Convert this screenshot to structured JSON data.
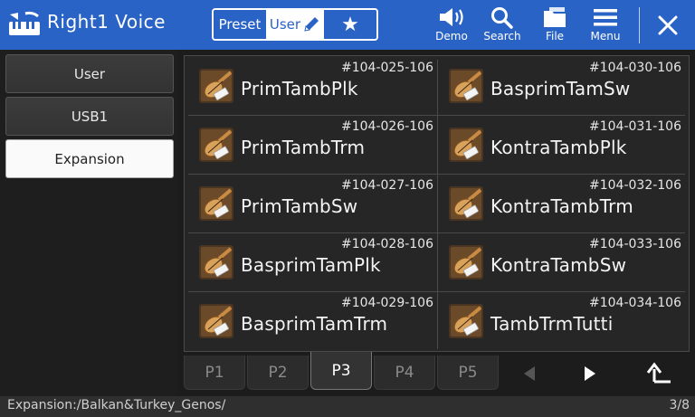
{
  "header": {
    "title": "Right1 Voice",
    "icon": "keyboard-voice-icon",
    "filters": {
      "preset_label": "Preset",
      "user_label": "User",
      "favorite_glyph": "★"
    },
    "tools": {
      "demo_label": "Demo",
      "search_label": "Search",
      "file_label": "File",
      "menu_label": "Menu"
    },
    "accent_color": "#2a63c6"
  },
  "sidebar": {
    "items": [
      {
        "label": "User",
        "active": false
      },
      {
        "label": "USB1",
        "active": false
      },
      {
        "label": "Expansion",
        "active": true
      }
    ]
  },
  "voices": [
    {
      "number": "#104-025-106",
      "name": "PrimTambPlk"
    },
    {
      "number": "#104-030-106",
      "name": "BasprimTamSw"
    },
    {
      "number": "#104-026-106",
      "name": "PrimTambTrm"
    },
    {
      "number": "#104-031-106",
      "name": "KontraTambPlk"
    },
    {
      "number": "#104-027-106",
      "name": "PrimTambSw"
    },
    {
      "number": "#104-032-106",
      "name": "KontraTambTrm"
    },
    {
      "number": "#104-028-106",
      "name": "BasprimTamPlk"
    },
    {
      "number": "#104-033-106",
      "name": "KontraTambSw"
    },
    {
      "number": "#104-029-106",
      "name": "BasprimTamTrm"
    },
    {
      "number": "#104-034-106",
      "name": "TambTrmTutti"
    }
  ],
  "pages": {
    "tabs": [
      "P1",
      "P2",
      "P3",
      "P4",
      "P5"
    ],
    "active": "P3"
  },
  "status": {
    "path": "Expansion:/Balkan&Turkey_Genos/",
    "page": "3/8"
  }
}
